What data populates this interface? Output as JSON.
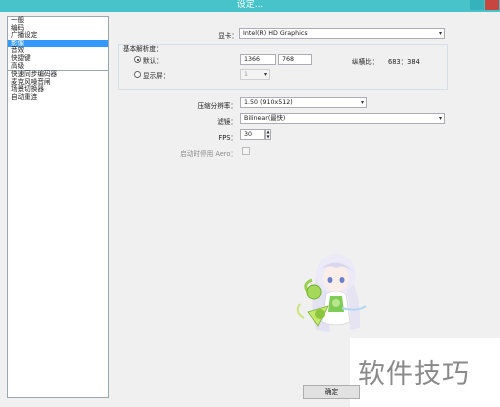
{
  "window": {
    "title": "设定..."
  },
  "sidebar": {
    "items": [
      {
        "label": "一般",
        "selected": false
      },
      {
        "label": "编码",
        "selected": false
      },
      {
        "label": "广播设定",
        "selected": false
      },
      {
        "label": "影像",
        "selected": true
      },
      {
        "label": "音效",
        "selected": false
      },
      {
        "label": "快捷键",
        "selected": false
      },
      {
        "label": "高级",
        "selected": false
      },
      {
        "label": "快速同步编码器",
        "selected": false
      },
      {
        "label": "麦克风噪音闸",
        "selected": false
      },
      {
        "label": "场景切换器",
        "selected": false
      },
      {
        "label": "自动重连",
        "selected": false
      }
    ]
  },
  "video": {
    "adapter_label": "显卡：",
    "adapter_value": "Intel(R) HD Graphics",
    "base_resolution_label": "基本解析度：",
    "default_label": "默认：",
    "width": "1366",
    "height": "768",
    "aspect_label": "纵横比：",
    "aspect_value": "683：384",
    "monitor_label": "显示屏：",
    "monitor_value": "1",
    "downscale_label": "压缩分辨率：",
    "downscale_value": "1.50  (910x512)",
    "filter_label": "滤镜：",
    "filter_value": "Bilinear(最快)",
    "fps_label": "FPS：",
    "fps_value": "30",
    "aero_label": "启动时停用 Aero："
  },
  "footer": {
    "ok_label": "确定"
  },
  "watermark": {
    "text": "软件技巧"
  },
  "colors": {
    "titlebar": "#47c3c9",
    "selection": "#3399ff"
  }
}
